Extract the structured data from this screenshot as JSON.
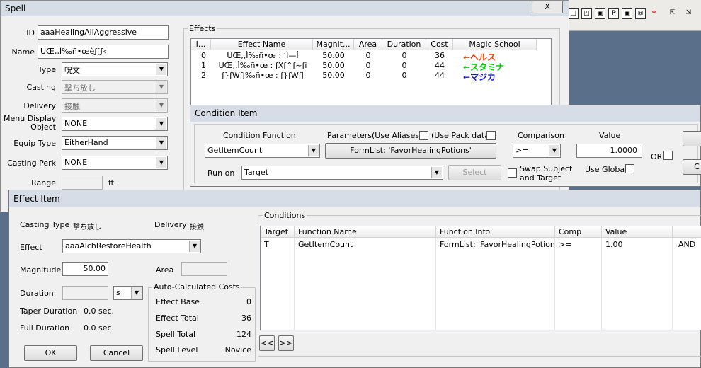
{
  "spell_window": {
    "title": "Spell",
    "close_label": "X",
    "id_label": "ID",
    "id_value": "aaaHealingAllAggressive",
    "name_label": "Name",
    "name_value": "UŒ‚‚Ì‰ñ•œèƒ[ƒ‹",
    "type_label": "Type",
    "type_value": "呪文",
    "casting_label": "Casting",
    "casting_value": "撃ち放し",
    "delivery_label": "Delivery",
    "delivery_value": "接触",
    "menu_display_label_1": "Menu Display",
    "menu_display_label_2": "Object",
    "menu_display_value": "NONE",
    "equip_type_label": "Equip Type",
    "equip_type_value": "EitherHand",
    "casting_perk_label": "Casting Perk",
    "casting_perk_value": "NONE",
    "range_label": "Range",
    "range_unit": "ft",
    "effects_group_label": "Effects",
    "effects_columns": [
      "I...",
      "Effect Name",
      "Magnit...",
      "Area",
      "Duration",
      "Cost",
      "Magic School"
    ],
    "effects_rows": [
      {
        "index": "0",
        "name": "UŒ‚‚Ì‰ñ•œ : ‘Ì—Í",
        "magnitude": "50.00",
        "area": "0",
        "duration": "0",
        "cost": "36",
        "school": "←ヘルス",
        "school_color": "#ff3c00"
      },
      {
        "index": "1",
        "name": "UŒ‚‚Ì‰ñ•œ : ƒXƒ^ƒ~ƒi",
        "magnitude": "50.00",
        "area": "0",
        "duration": "0",
        "cost": "44",
        "school": "←スタミナ",
        "school_color": "#00d000"
      },
      {
        "index": "2",
        "name": "ƒ}ƒWƒJ‰ñ•œ : ƒ}ƒWƒJ",
        "magnitude": "50.00",
        "area": "0",
        "duration": "0",
        "cost": "44",
        "school": "←マジカ",
        "school_color": "#1414e0"
      }
    ]
  },
  "condition_window": {
    "title": "Condition Item",
    "function_label": "Condition Function",
    "function_value": "GetItemCount",
    "parameters_label": "Parameters",
    "use_aliases_label": "(Use Aliases)",
    "use_pack_data_label": "(Use Pack data)",
    "param_button_label": "FormList: 'FavorHealingPotions'",
    "comparison_label": "Comparison",
    "comparison_value": ">=",
    "value_label": "Value",
    "value_value": "1.0000",
    "or_label": "OR",
    "run_on_label": "Run on",
    "run_on_value": "Target",
    "select_button_label": "Select",
    "swap_subject_label_1": "Swap Subject",
    "swap_subject_label_2": "and Target",
    "use_global_label": "Use Global",
    "right_button_2_label": "C"
  },
  "effect_window": {
    "title": "Effect Item",
    "casting_type_label": "Casting Type",
    "casting_type_value": "撃ち放し",
    "delivery_label": "Delivery",
    "delivery_value": "接触",
    "effect_label": "Effect",
    "effect_value": "aaaAlchRestoreHealth",
    "magnitude_label": "Magnitude",
    "magnitude_value": "50.00",
    "area_label": "Area",
    "duration_label": "Duration",
    "duration_unit": "s",
    "taper_label": "Taper Duration",
    "taper_value": "0.0 sec.",
    "full_label": "Full Duration",
    "full_value": "0.0 sec.",
    "auto_costs_label": "Auto-Calculated Costs",
    "effect_base_label": "Effect Base",
    "effect_base_value": "0",
    "effect_total_label": "Effect Total",
    "effect_total_value": "36",
    "spell_total_label": "Spell Total",
    "spell_total_value": "124",
    "spell_level_label": "Spell Level",
    "spell_level_value": "Novice",
    "ok_label": "OK",
    "cancel_label": "Cancel",
    "conditions_label": "Conditions",
    "conditions_columns": [
      "Target",
      "Function Name",
      "Function Info",
      "Comp",
      "Value"
    ],
    "conditions_rows": [
      {
        "target": "T",
        "function": "GetItemCount",
        "info": "FormList: 'FavorHealingPotions'",
        "comp": ">=",
        "value": "1.00",
        "extra": "AND"
      }
    ],
    "prev_button_label": "<<",
    "next_button_label": ">>"
  },
  "toolbar": {
    "icons": [
      "box-icon",
      "box-icon",
      "box-icon",
      "p-icon",
      "box-icon",
      "x-box-icon",
      "link-icon",
      "pointer-icon"
    ]
  }
}
